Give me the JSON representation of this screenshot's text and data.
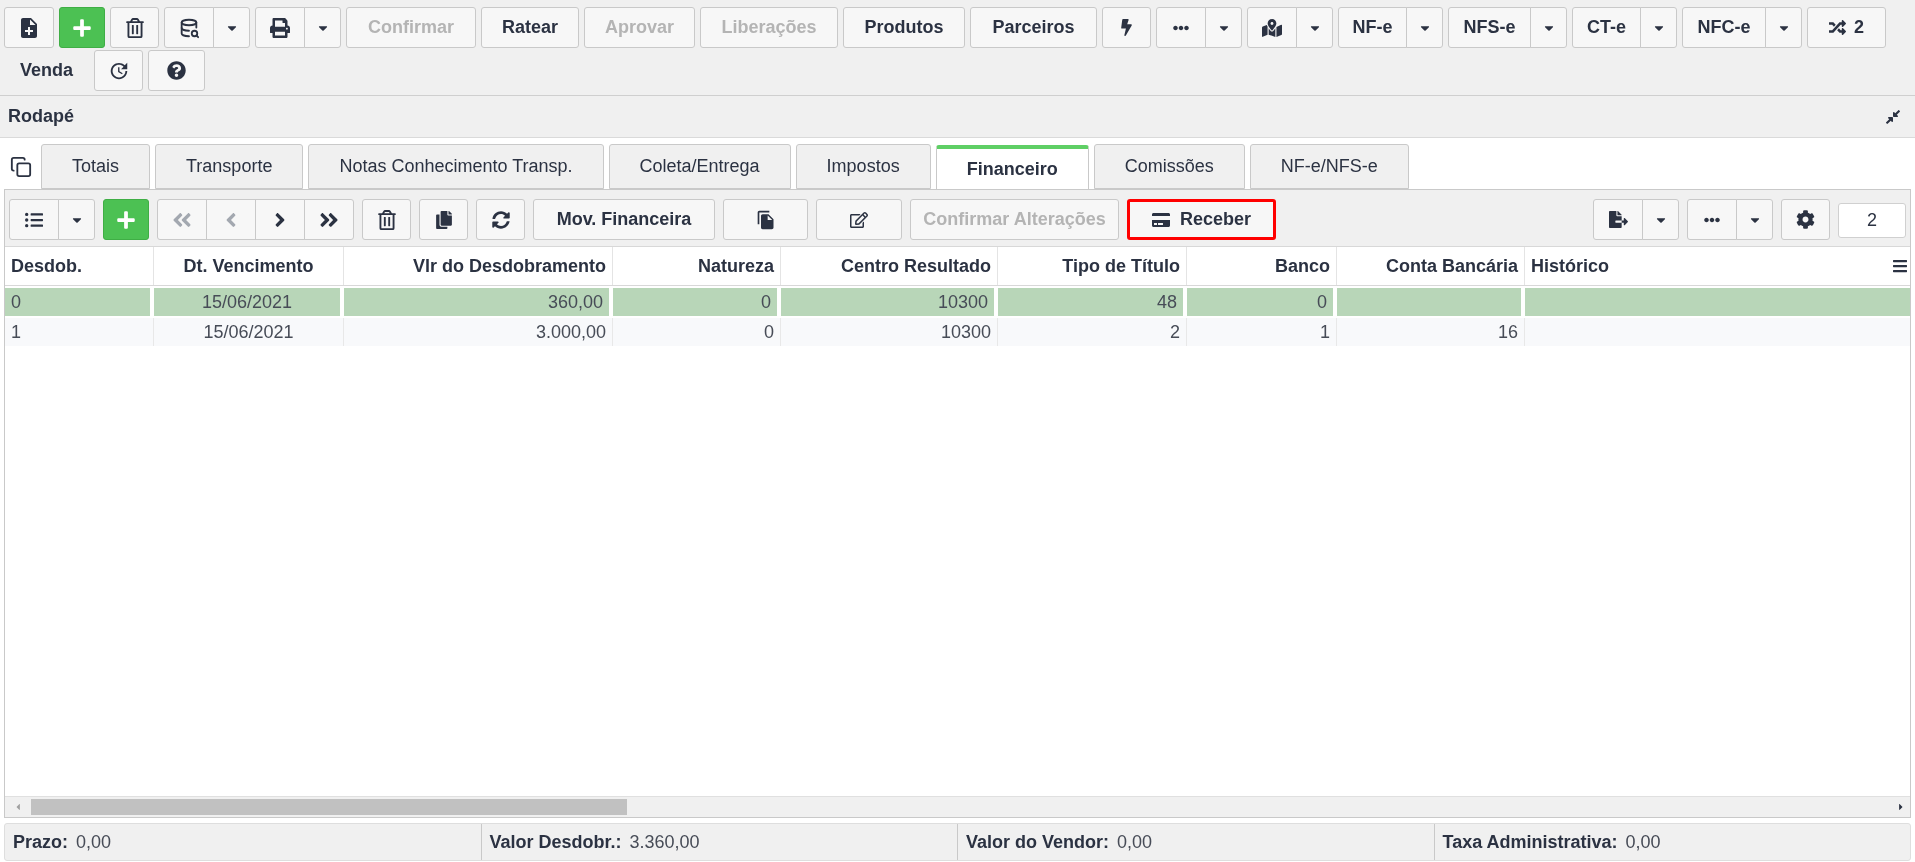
{
  "toolbar": {
    "buttons": [
      {
        "label": "Confirmar",
        "disabled": true
      },
      {
        "label": "Ratear",
        "disabled": false
      },
      {
        "label": "Aprovar",
        "disabled": true
      },
      {
        "label": "Liberações",
        "disabled": true
      },
      {
        "label": "Produtos",
        "disabled": false
      },
      {
        "label": "Parceiros",
        "disabled": false
      }
    ],
    "document_menus": [
      {
        "label": "NF-e"
      },
      {
        "label": "NFS-e"
      },
      {
        "label": "CT-e"
      },
      {
        "label": "NFC-e"
      }
    ],
    "shuffle_count": "2",
    "context_label": "Venda"
  },
  "panel": {
    "title": "Rodapé"
  },
  "tabs": [
    {
      "label": "Totais",
      "selected": false
    },
    {
      "label": "Transporte",
      "selected": false
    },
    {
      "label": "Notas Conhecimento Transp.",
      "selected": false
    },
    {
      "label": "Coleta/Entrega",
      "selected": false
    },
    {
      "label": "Impostos",
      "selected": false
    },
    {
      "label": "Financeiro",
      "selected": true
    },
    {
      "label": "Comissões",
      "selected": false
    },
    {
      "label": "NF-e/NFS-e",
      "selected": false
    }
  ],
  "grid_toolbar": {
    "navigation": [
      {
        "disabled": true
      },
      {
        "disabled": true
      },
      {
        "disabled": false
      },
      {
        "disabled": false
      }
    ],
    "buttons": [
      {
        "label": "Mov. Financeira",
        "disabled": false,
        "highlighted": false
      },
      {
        "label": "Confirmar Alterações",
        "disabled": true,
        "highlighted": false
      },
      {
        "label": "Receber",
        "disabled": false,
        "highlighted": true
      }
    ],
    "record_count": "2"
  },
  "table": {
    "columns": [
      "Desdob.",
      "Dt. Vencimento",
      "Vlr do Desdobramento",
      "Natureza",
      "Centro Resultado",
      "Tipo de Título",
      "Banco",
      "Conta Bancária",
      "Histórico"
    ],
    "rows": [
      {
        "selected": true,
        "cells": [
          "0",
          "15/06/2021",
          "360,00",
          "0",
          "10300",
          "48",
          "0"
        ]
      },
      {
        "selected": false,
        "cells": [
          "1",
          "15/06/2021",
          "3.000,00",
          "0",
          "10300",
          "2",
          "1",
          "16"
        ]
      }
    ]
  },
  "status_bar": [
    {
      "label": "Prazo:",
      "value": "0,00"
    },
    {
      "label": "Valor Desdobr.:",
      "value": "3.360,00"
    },
    {
      "label": "Valor do Vendor:",
      "value": "0,00"
    },
    {
      "label": "Taxa Administrativa:",
      "value": "0,00"
    }
  ]
}
